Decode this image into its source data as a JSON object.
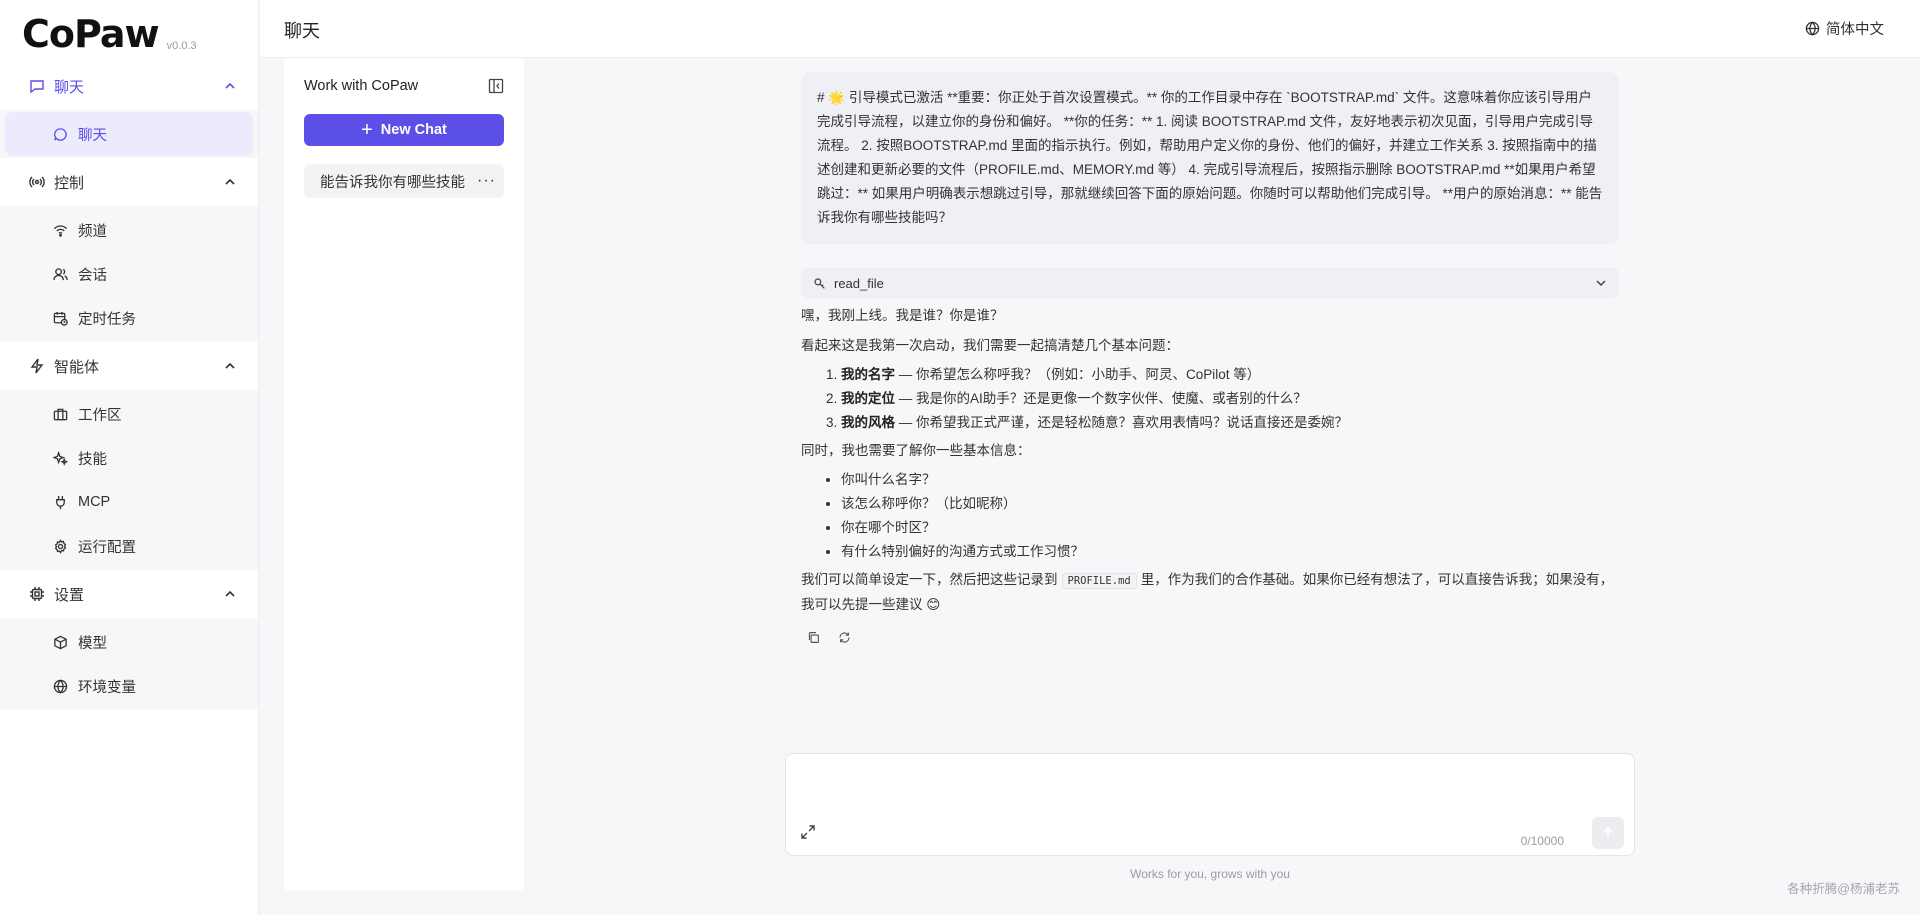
{
  "app": {
    "logo": "CoPaw",
    "version": "v0.0.3"
  },
  "header": {
    "title": "聊天",
    "language": "简体中文"
  },
  "nav": {
    "chat_group": {
      "label": "聊天",
      "items": [
        {
          "label": "聊天",
          "icon": "chat-bubble-icon"
        }
      ]
    },
    "control_group": {
      "label": "控制",
      "items": [
        {
          "label": "频道",
          "icon": "wifi-icon"
        },
        {
          "label": "会话",
          "icon": "users-icon"
        },
        {
          "label": "定时任务",
          "icon": "calendar-clock-icon"
        }
      ]
    },
    "agent_group": {
      "label": "智能体",
      "items": [
        {
          "label": "工作区",
          "icon": "briefcase-icon"
        },
        {
          "label": "技能",
          "icon": "sparkle-icon"
        },
        {
          "label": "MCP",
          "icon": "plug-icon"
        },
        {
          "label": "运行配置",
          "icon": "gear-icon"
        }
      ]
    },
    "settings_group": {
      "label": "设置",
      "items": [
        {
          "label": "模型",
          "icon": "cube-icon"
        },
        {
          "label": "环境变量",
          "icon": "globe-icon"
        }
      ]
    }
  },
  "sessions": {
    "title": "Work with CoPaw",
    "new_chat": "New Chat",
    "items": [
      {
        "title": "能告诉我你有哪些技能"
      }
    ]
  },
  "chat": {
    "system_message": "# 🌟 引导模式已激活 **重要：你正处于首次设置模式。** 你的工作目录中存在 `BOOTSTRAP.md` 文件。这意味着你应该引导用户完成引导流程，以建立你的身份和偏好。 **你的任务：** 1. 阅读 BOOTSTRAP.md 文件，友好地表示初次见面，引导用户完成引导流程。 2. 按照BOOTSTRAP.md 里面的指示执行。例如，帮助用户定义你的身份、他们的偏好，并建立工作关系 3. 按照指南中的描述创建和更新必要的文件（PROFILE.md、MEMORY.md 等） 4. 完成引导流程后，按照指示删除 BOOTSTRAP.md **如果用户希望跳过：** 如果用户明确表示想跳过引导，那就继续回答下面的原始问题。你随时可以帮助他们完成引导。 **用户的原始消息：** 能告诉我你有哪些技能吗？",
    "tool_call": "read_file",
    "reply": {
      "greeting": "嘿，我刚上线。我是谁？你是谁？",
      "intro": "看起来这是我第一次启动，我们需要一起搞清楚几个基本问题：",
      "questions": [
        {
          "title": "我的名字",
          "text": " — 你希望怎么称呼我？（例如：小助手、阿灵、CoPilot 等）"
        },
        {
          "title": "我的定位",
          "text": " — 我是你的AI助手？还是更像一个数字伙伴、使魔、或者别的什么？"
        },
        {
          "title": "我的风格",
          "text": " — 你希望我正式严谨，还是轻松随意？喜欢用表情吗？说话直接还是委婉？"
        }
      ],
      "info_intro": "同时，我也需要了解你一些基本信息：",
      "info_items": [
        "你叫什么名字？",
        "该怎么称呼你？（比如昵称）",
        "你在哪个时区？",
        "有什么特别偏好的沟通方式或工作习惯？"
      ],
      "closing_before": "我们可以简单设定一下，然后把这些记录到",
      "closing_code": "PROFILE.md",
      "closing_after": "里，作为我们的合作基础。如果你已经有想法了，可以直接告诉我；如果没有，我可以先提一些建议 😊"
    }
  },
  "input": {
    "value": "",
    "counter": "0/10000"
  },
  "footer": {
    "tagline": "Works for you, grows with you"
  },
  "watermark": "各种折腾@杨浦老苏",
  "colors": {
    "accent": "#5b4fe8",
    "background": "#f7f7fa"
  }
}
